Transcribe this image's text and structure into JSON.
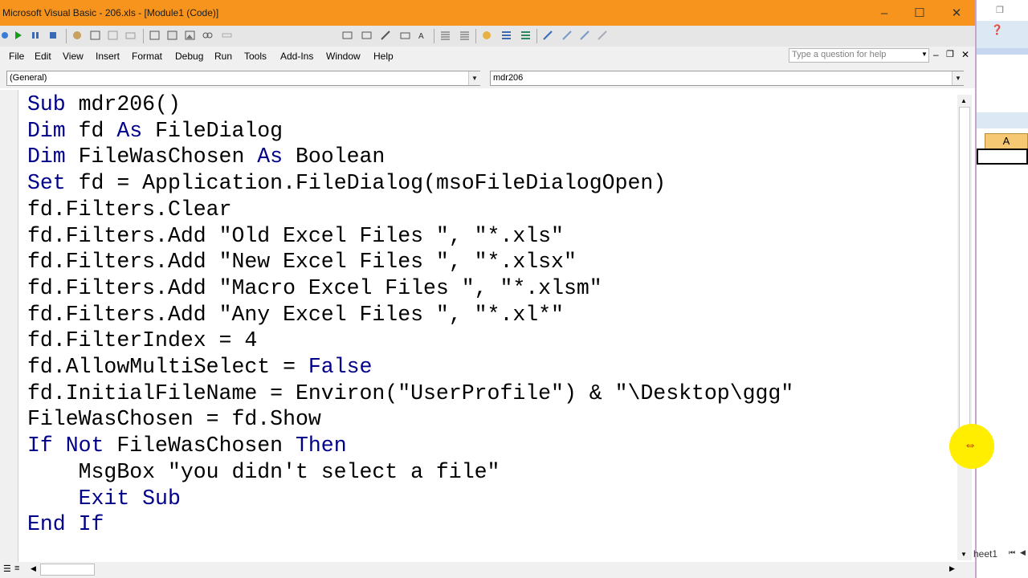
{
  "window": {
    "title": "Microsoft Visual Basic - 206.xls - [Module1 (Code)]",
    "minimize": "–",
    "maximize": "☐",
    "close": "✕"
  },
  "menu": {
    "items": [
      "File",
      "Edit",
      "View",
      "Insert",
      "Format",
      "Debug",
      "Run",
      "Tools",
      "Add-Ins",
      "Window",
      "Help"
    ],
    "help_placeholder": "Type a question for help"
  },
  "combos": {
    "object": "(General)",
    "procedure": "mdr206"
  },
  "code": {
    "lines": [
      "Sub mdr206()",
      "Dim fd As FileDialog",
      "Dim FileWasChosen As Boolean",
      "Set fd = Application.FileDialog(msoFileDialogOpen)",
      "fd.Filters.Clear",
      "fd.Filters.Add \"Old Excel Files \", \"*.xls\"",
      "fd.Filters.Add \"New Excel Files \", \"*.xlsx\"",
      "fd.Filters.Add \"Macro Excel Files \", \"*.xlsm\"",
      "fd.Filters.Add \"Any Excel Files \", \"*.xl*\"",
      "fd.FilterIndex = 4",
      "fd.AllowMultiSelect = False",
      "fd.InitialFileName = Environ(\"UserProfile\") & \"\\Desktop\\ggg\"",
      "FileWasChosen = fd.Show",
      "If Not FileWasChosen Then",
      "    MsgBox \"you didn't select a file\"",
      "    Exit Sub",
      "End If"
    ],
    "keywords": [
      "Sub",
      "Dim",
      "As",
      "Set",
      "False",
      "If",
      "Not",
      "Then",
      "Exit",
      "End"
    ]
  },
  "excel": {
    "column_header": "A",
    "sheet_tab": "heet1"
  },
  "colors": {
    "titlebar": "#f7941d",
    "keyword": "#00008b",
    "cursor_highlight": "#ffee00"
  }
}
